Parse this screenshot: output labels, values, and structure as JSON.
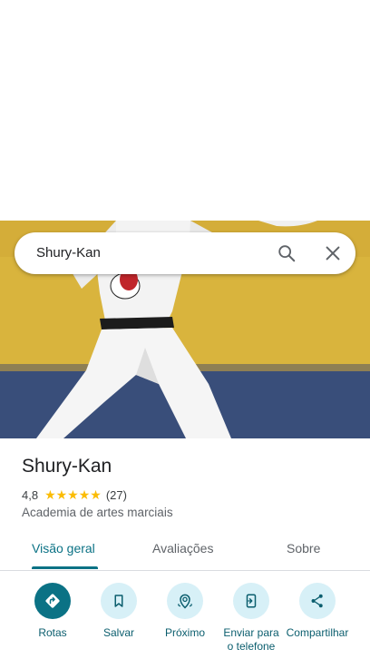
{
  "search": {
    "query": "Shury-Kan"
  },
  "place": {
    "name": "Shury-Kan",
    "rating": "4,8",
    "stars": "★★★★★",
    "reviews": "(27)",
    "category": "Academia de artes marciais"
  },
  "tabs": [
    {
      "label": "Visão geral",
      "active": true
    },
    {
      "label": "Avaliações",
      "active": false
    },
    {
      "label": "Sobre",
      "active": false
    }
  ],
  "actions": [
    {
      "label": "Rotas",
      "icon": "directions-icon"
    },
    {
      "label": "Salvar",
      "icon": "bookmark-icon"
    },
    {
      "label": "Próximo",
      "icon": "nearby-icon"
    },
    {
      "label": "Enviar para o telefone",
      "icon": "send-to-phone-icon"
    },
    {
      "label": "Compartilhar",
      "icon": "share-icon"
    }
  ],
  "colors": {
    "accent": "#0b7285",
    "action_bg": "#d7f0f7",
    "star": "#fbbc04"
  }
}
